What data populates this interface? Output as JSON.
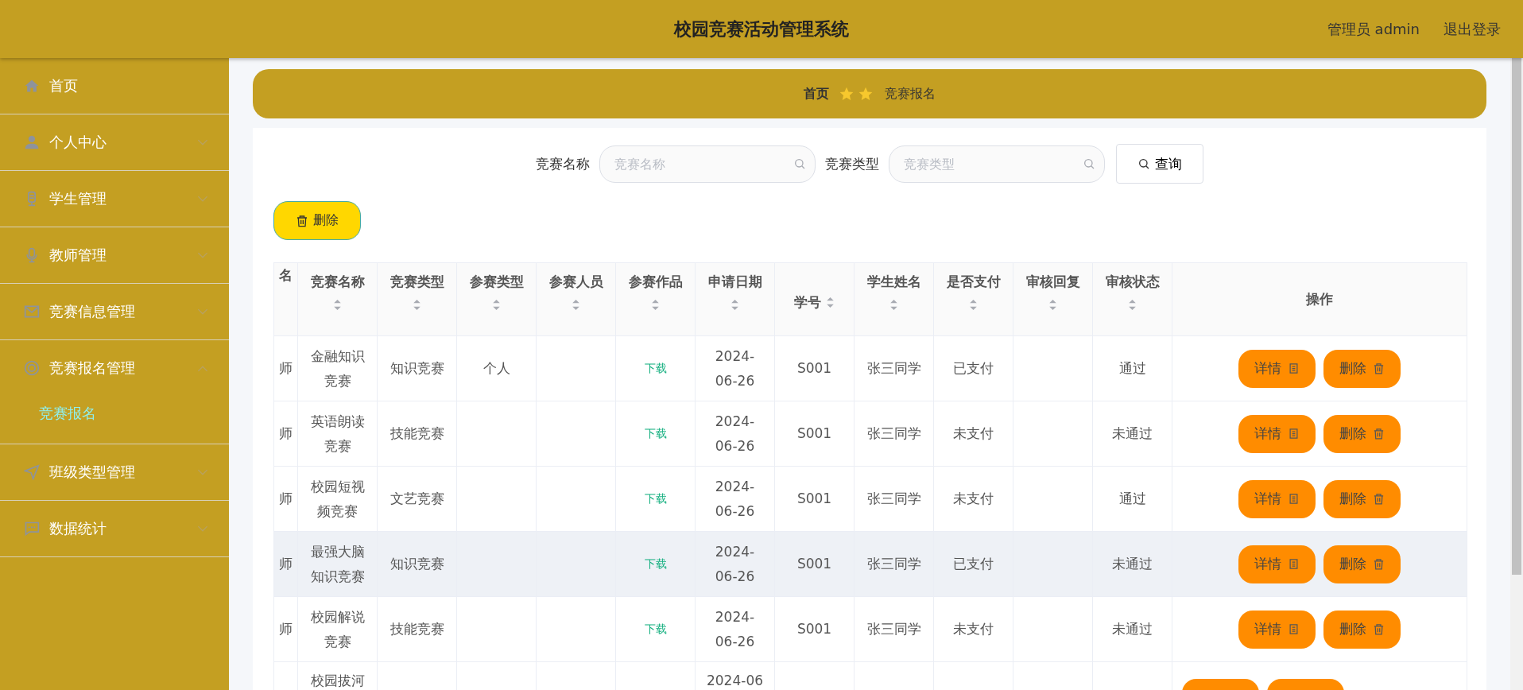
{
  "header": {
    "title": "校园竞赛活动管理系统",
    "user": "管理员 admin",
    "logout": "退出登录"
  },
  "sidebar": {
    "items": [
      {
        "label": "首页",
        "kind": "link"
      },
      {
        "label": "个人中心",
        "kind": "group",
        "expanded": false
      },
      {
        "label": "学生管理",
        "kind": "group",
        "expanded": false
      },
      {
        "label": "教师管理",
        "kind": "group",
        "expanded": false
      },
      {
        "label": "竞赛信息管理",
        "kind": "group",
        "expanded": false
      },
      {
        "label": "竞赛报名管理",
        "kind": "group",
        "expanded": true,
        "children": [
          {
            "label": "竞赛报名",
            "selected": true
          }
        ]
      },
      {
        "label": "班级类型管理",
        "kind": "group",
        "expanded": false
      },
      {
        "label": "数据统计",
        "kind": "group",
        "expanded": false
      }
    ]
  },
  "breadcrumb": {
    "home": "首页",
    "current": "竞赛报名"
  },
  "search": {
    "fields": [
      {
        "label": "竞赛名称",
        "placeholder": "竞赛名称"
      },
      {
        "label": "竞赛类型",
        "placeholder": "竞赛类型"
      }
    ],
    "button": "查询"
  },
  "delete_button": "删除",
  "table": {
    "columns": [
      {
        "label": "名",
        "kind": "plain"
      },
      {
        "label": "竞赛名称",
        "kind": "sortable"
      },
      {
        "label": "竞赛类型",
        "kind": "sortable"
      },
      {
        "label": "参赛类型",
        "kind": "sortable"
      },
      {
        "label": "参赛人员",
        "kind": "sortable"
      },
      {
        "label": "参赛作品",
        "kind": "sortable"
      },
      {
        "label": "申请日期",
        "kind": "sortable"
      },
      {
        "label": "学号",
        "kind": "sortable-inline"
      },
      {
        "label": "学生姓名",
        "kind": "sortable"
      },
      {
        "label": "是否支付",
        "kind": "sortable"
      },
      {
        "label": "审核回复",
        "kind": "sortable"
      },
      {
        "label": "审核状态",
        "kind": "sortable"
      },
      {
        "label": "操作",
        "kind": "plain"
      }
    ],
    "rows": [
      {
        "hover": false,
        "cells": [
          "师",
          "金融知识竞赛",
          "知识竞赛",
          "个人",
          "",
          "下载",
          "2024-06-26",
          "S001",
          "张三同学",
          "已支付",
          "",
          "通过"
        ],
        "actions": [
          "详情",
          "删除"
        ]
      },
      {
        "hover": false,
        "cells": [
          "师",
          "英语朗读竞赛",
          "技能竞赛",
          "",
          "",
          "下载",
          "2024-06-26",
          "S001",
          "张三同学",
          "未支付",
          "",
          "未通过"
        ],
        "actions": [
          "详情",
          "删除"
        ]
      },
      {
        "hover": false,
        "cells": [
          "师",
          "校园短视频竞赛",
          "文艺竞赛",
          "",
          "",
          "下载",
          "2024-06-26",
          "S001",
          "张三同学",
          "未支付",
          "",
          "通过"
        ],
        "actions": [
          "详情",
          "删除"
        ]
      },
      {
        "hover": true,
        "cells": [
          "师",
          "最强大脑知识竞赛",
          "知识竞赛",
          "",
          "",
          "下载",
          "2024-06-26",
          "S001",
          "张三同学",
          "已支付",
          "",
          "未通过"
        ],
        "actions": [
          "详情",
          "删除"
        ]
      },
      {
        "hover": false,
        "cells": [
          "师",
          "校园解说竞赛",
          "技能竞赛",
          "",
          "",
          "下载",
          "2024-06-26",
          "S001",
          "张三同学",
          "未支付",
          "",
          "未通过"
        ],
        "actions": [
          "详情",
          "删除"
        ]
      },
      {
        "hover": false,
        "kind": "cut",
        "cells": [
          "",
          "校园拔河",
          "",
          "",
          "",
          "",
          "2024-06",
          "",
          "",
          "",
          "",
          ""
        ]
      }
    ]
  }
}
